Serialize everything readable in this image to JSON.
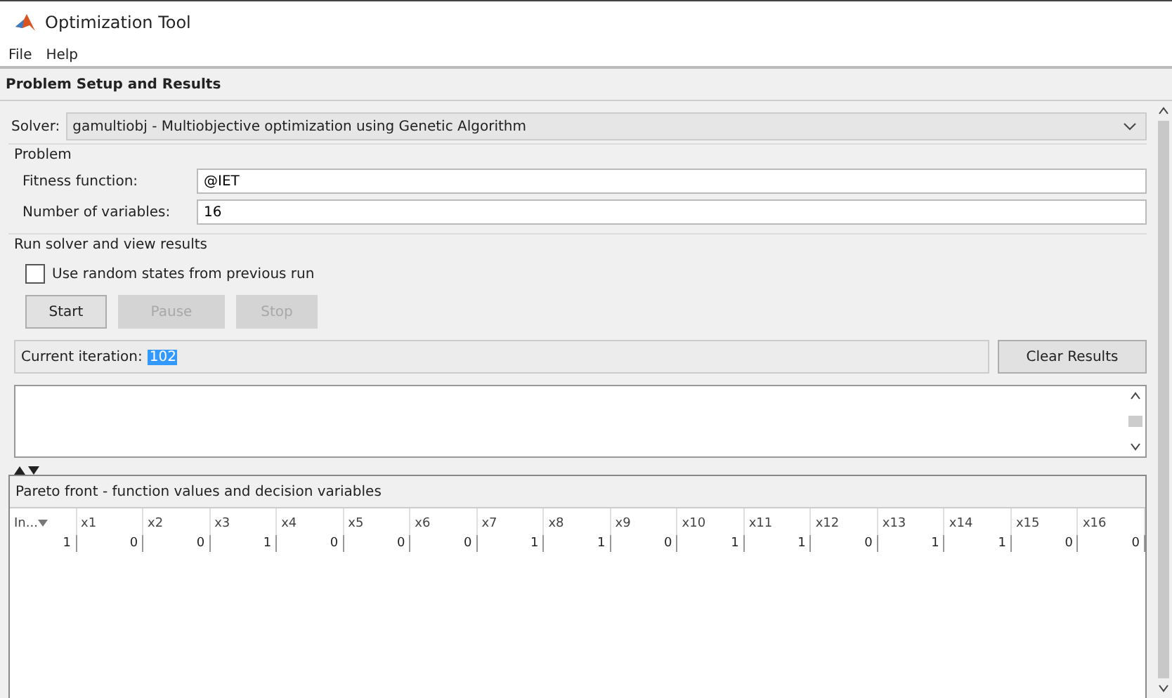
{
  "window": {
    "title": "Optimization Tool"
  },
  "menu": [
    "File",
    "Help"
  ],
  "section_title": "Problem Setup and Results",
  "solver": {
    "label": "Solver:",
    "value": "gamultiobj - Multiobjective optimization using Genetic Algorithm"
  },
  "problem": {
    "title": "Problem",
    "fields": [
      {
        "label": "Fitness function:",
        "value": "@IET"
      },
      {
        "label": "Number of variables:",
        "value": "16"
      }
    ]
  },
  "run": {
    "title": "Run solver and view results",
    "checkbox": {
      "label": "Use random states from previous run",
      "checked": false
    },
    "buttons": [
      {
        "label": "Start",
        "disabled": false
      },
      {
        "label": "Pause",
        "disabled": true
      },
      {
        "label": "Stop",
        "disabled": true
      }
    ],
    "iteration": {
      "label": "Current iteration:",
      "value": "102",
      "selected": true
    },
    "clear_button": "Clear Results"
  },
  "pareto": {
    "title": "Pareto front - function values and decision variables",
    "columns": [
      "In...",
      "x1",
      "x2",
      "x3",
      "x4",
      "x5",
      "x6",
      "x7",
      "x8",
      "x9",
      "x10",
      "x11",
      "x12",
      "x13",
      "x14",
      "x15",
      "x16"
    ],
    "rows": [
      [
        "1",
        "0",
        "0",
        "1",
        "0",
        "0",
        "0",
        "1",
        "1",
        "0",
        "1",
        "1",
        "0",
        "1",
        "1",
        "0",
        "0"
      ]
    ]
  }
}
